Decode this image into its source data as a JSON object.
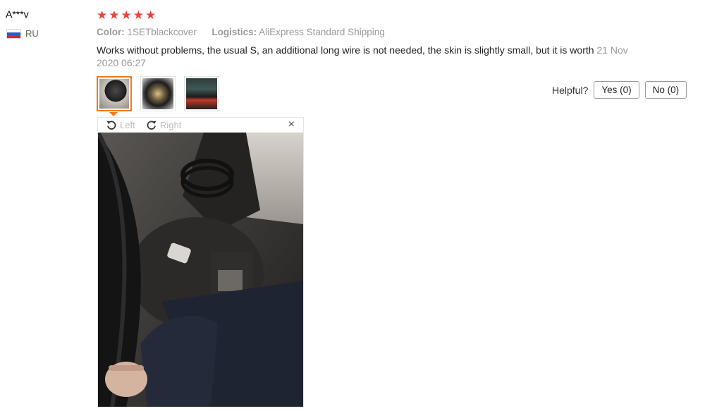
{
  "review": {
    "user": "A***v",
    "country": "RU",
    "rating": 5,
    "stars": [
      "★",
      "★",
      "★",
      "★",
      "★"
    ],
    "color_label": "Color:",
    "color_value": "1SETblackcover",
    "logistics_label": "Logistics:",
    "logistics_value": "AliExpress Standard Shipping",
    "text": "Works without problems, the usual S, an additional long wire is not needed, the skin is slightly small, but it is worth",
    "date": "21 Nov 2020 06:27"
  },
  "helpful": {
    "label": "Helpful?",
    "yes": "Yes (0)",
    "no": "No (0)"
  },
  "viewer": {
    "rotate_left": "Left",
    "rotate_right": "Right",
    "close": "×"
  },
  "colors": {
    "star": "#e8423c",
    "active_border": "#f27a1a",
    "muted": "#999999"
  }
}
